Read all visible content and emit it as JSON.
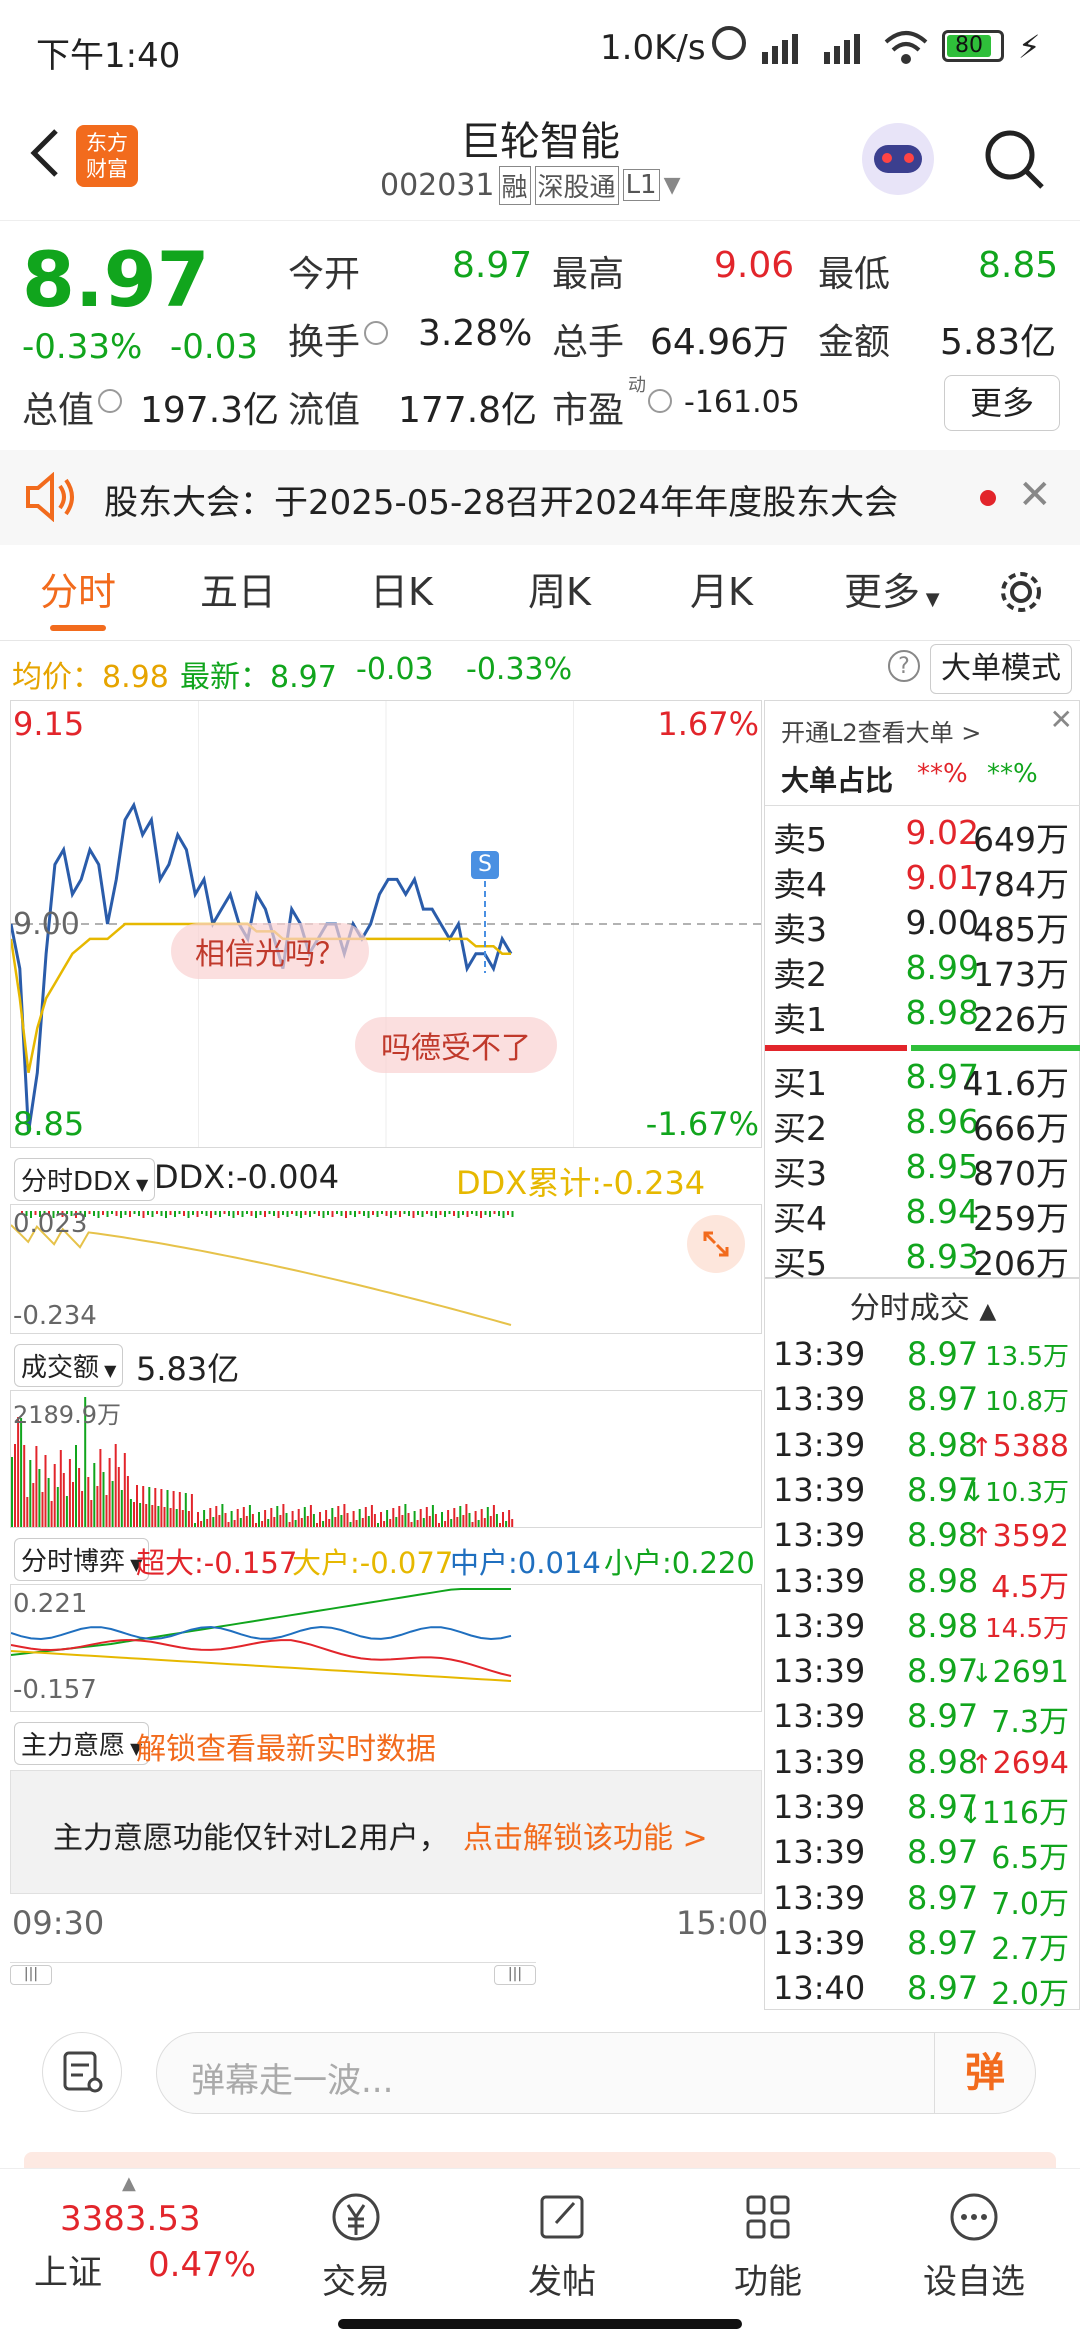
{
  "status": {
    "time": "下午1:40",
    "net_speed": "1.0K/s",
    "battery": "80"
  },
  "header": {
    "back_icon": "chevron-left-icon",
    "logo_text": "东方财富",
    "stock_name": "巨轮智能",
    "stock_code": "002031",
    "tags": [
      "融",
      "深股通",
      "L1"
    ]
  },
  "quote": {
    "price": "8.97",
    "change_pct": "-0.33%",
    "change": "-0.03",
    "fields": [
      {
        "label": "今开",
        "value": "8.97",
        "color": "green"
      },
      {
        "label": "最高",
        "value": "9.06",
        "color": "red"
      },
      {
        "label": "最低",
        "value": "8.85",
        "color": "green"
      },
      {
        "label": "换手",
        "value": "3.28%",
        "color": "plain"
      },
      {
        "label": "总手",
        "value": "64.96万",
        "color": "plain"
      },
      {
        "label": "金额",
        "value": "5.83亿",
        "color": "plain"
      },
      {
        "label": "总值",
        "value": "197.3亿",
        "color": "plain"
      },
      {
        "label": "流值",
        "value": "177.8亿",
        "color": "plain"
      },
      {
        "label": "市盈",
        "value": "-161.05",
        "color": "plain"
      }
    ],
    "pe_superscript": "动",
    "more_button": "更多"
  },
  "notice": {
    "text": "股东大会：于2025-05-28召开2024年年度股东大会"
  },
  "tabs": [
    "分时",
    "五日",
    "日K",
    "周K",
    "月K",
    "更多"
  ],
  "active_tab": "分时",
  "chart_header": {
    "avg_label": "均价：",
    "avg_value": "8.98",
    "latest_label": "最新：",
    "latest_value": "8.97",
    "change": "-0.03",
    "change_pct": "-0.33%",
    "mode_button": "大单模式"
  },
  "chart_data": {
    "type": "line",
    "ylim": [
      8.85,
      9.15
    ],
    "y_top_label": "9.15",
    "y_bottom_label": "8.85",
    "y_mid_label": "9.00",
    "pct_top": "1.67%",
    "pct_bottom": "-1.67%",
    "x_start": "09:30",
    "x_end": "15:00",
    "series": [
      {
        "values": [
          9.0,
          8.97,
          8.86,
          8.9,
          8.98,
          9.04,
          9.05,
          9.02,
          9.03,
          9.05,
          9.04,
          9.0,
          9.03,
          9.07,
          9.08,
          9.06,
          9.07,
          9.03,
          9.04,
          9.06,
          9.05,
          9.02,
          9.03,
          9.0,
          9.01,
          9.02,
          9.0,
          8.99,
          9.02,
          9.01,
          8.99,
          8.97,
          9.01,
          9.0,
          8.98,
          8.99,
          9.0,
          9.0,
          8.98,
          9.0,
          8.99,
          9.0,
          9.02,
          9.03,
          9.03,
          9.02,
          9.03,
          9.01,
          9.01,
          9.0,
          8.99,
          9.0,
          8.97,
          8.98,
          8.98,
          8.97,
          8.99,
          8.98
        ]
      },
      {
        "values": [
          8.99,
          8.95,
          8.9,
          8.93,
          8.95,
          8.96,
          8.97,
          8.98,
          8.985,
          8.99,
          8.99,
          8.99,
          8.995,
          9.0,
          9.0,
          9.0,
          9.0,
          9.0,
          9.0,
          9.0,
          9.0,
          9.0,
          9.0,
          9.0,
          9.0,
          9.0,
          9.0,
          9.0,
          8.995,
          8.995,
          8.995,
          8.99,
          8.99,
          8.99,
          8.99,
          8.99,
          8.99,
          8.99,
          8.99,
          8.99,
          8.99,
          8.99,
          8.99,
          8.99,
          8.99,
          8.99,
          8.99,
          8.99,
          8.99,
          8.99,
          8.99,
          8.99,
          8.99,
          8.985,
          8.985,
          8.985,
          8.98,
          8.98
        ]
      }
    ],
    "danmaku": [
      "相信光吗？",
      "吗德受不了"
    ],
    "s_marker": "S"
  },
  "ddx": {
    "selector": "分时DDX",
    "value_label": "DDX:",
    "value": "-0.004",
    "cum_label": "DDX累计:",
    "cum_value": "-0.234",
    "top": "0.023",
    "bottom": "-0.234"
  },
  "volume": {
    "selector": "成交额",
    "value": "5.83亿",
    "max_label": "2189.9万"
  },
  "game": {
    "selector": "分时博弈",
    "items": [
      {
        "label": "超大:",
        "value": "-0.157",
        "color": "#e2252b"
      },
      {
        "label": "大户:",
        "value": "-0.077",
        "color": "#e6b800"
      },
      {
        "label": "中户:",
        "value": "0.014",
        "color": "#1f6fbf"
      },
      {
        "label": "小户:",
        "value": "0.220",
        "color": "#11a51d"
      }
    ],
    "top": "0.221",
    "bottom": "-0.157"
  },
  "main_intent": {
    "selector": "主力意愿",
    "unlock_text": "解锁查看最新实时数据",
    "promo_text": "主力意愿功能仅针对L2用户，",
    "promo_link": "点击解锁该功能 >"
  },
  "orderbook": {
    "open_l2": "开通L2查看大单 >",
    "big_ratio_label": "大单占比",
    "big_ratio_red": "**%",
    "big_ratio_green": "**%",
    "sells": [
      {
        "label": "卖5",
        "price": "9.02",
        "vol": "649万",
        "color": "red"
      },
      {
        "label": "卖4",
        "price": "9.01",
        "vol": "784万",
        "color": "red"
      },
      {
        "label": "卖3",
        "price": "9.00",
        "vol": "485万",
        "color": "plain"
      },
      {
        "label": "卖2",
        "price": "8.99",
        "vol": "173万",
        "color": "green"
      },
      {
        "label": "卖1",
        "price": "8.98",
        "vol": "226万",
        "color": "green"
      }
    ],
    "buys": [
      {
        "label": "买1",
        "price": "8.97",
        "vol": "41.6万",
        "color": "green"
      },
      {
        "label": "买2",
        "price": "8.96",
        "vol": "666万",
        "color": "green"
      },
      {
        "label": "买3",
        "price": "8.95",
        "vol": "870万",
        "color": "green"
      },
      {
        "label": "买4",
        "price": "8.94",
        "vol": "259万",
        "color": "green"
      },
      {
        "label": "买5",
        "price": "8.93",
        "vol": "206万",
        "color": "green"
      }
    ],
    "sell_ratio": 0.45,
    "trades_title": "分时成交",
    "trades": [
      {
        "t": "13:39",
        "p": "8.97",
        "v": "13.5万",
        "pc": "green",
        "vc": "green",
        "arrow": ""
      },
      {
        "t": "13:39",
        "p": "8.97",
        "v": "10.8万",
        "pc": "green",
        "vc": "green",
        "arrow": ""
      },
      {
        "t": "13:39",
        "p": "8.98",
        "v": "5388",
        "pc": "green",
        "vc": "red",
        "arrow": "↑"
      },
      {
        "t": "13:39",
        "p": "8.97",
        "v": "10.3万",
        "pc": "green",
        "vc": "green",
        "arrow": "↓"
      },
      {
        "t": "13:39",
        "p": "8.98",
        "v": "3592",
        "pc": "green",
        "vc": "red",
        "arrow": "↑"
      },
      {
        "t": "13:39",
        "p": "8.98",
        "v": "4.5万",
        "pc": "green",
        "vc": "red",
        "arrow": ""
      },
      {
        "t": "13:39",
        "p": "8.98",
        "v": "14.5万",
        "pc": "green",
        "vc": "red",
        "arrow": ""
      },
      {
        "t": "13:39",
        "p": "8.97",
        "v": "2691",
        "pc": "green",
        "vc": "green",
        "arrow": "↓"
      },
      {
        "t": "13:39",
        "p": "8.97",
        "v": "7.3万",
        "pc": "green",
        "vc": "green",
        "arrow": ""
      },
      {
        "t": "13:39",
        "p": "8.98",
        "v": "2694",
        "pc": "green",
        "vc": "red",
        "arrow": "↑"
      },
      {
        "t": "13:39",
        "p": "8.97",
        "v": "116万",
        "pc": "green",
        "vc": "green",
        "arrow": "↓"
      },
      {
        "t": "13:39",
        "p": "8.97",
        "v": "6.5万",
        "pc": "green",
        "vc": "green",
        "arrow": ""
      },
      {
        "t": "13:39",
        "p": "8.97",
        "v": "7.0万",
        "pc": "green",
        "vc": "green",
        "arrow": ""
      },
      {
        "t": "13:39",
        "p": "8.97",
        "v": "2.7万",
        "pc": "green",
        "vc": "green",
        "arrow": ""
      },
      {
        "t": "13:40",
        "p": "8.97",
        "v": "2.0万",
        "pc": "green",
        "vc": "green",
        "arrow": ""
      }
    ]
  },
  "danmu_input": {
    "placeholder": "弹幕走一波...",
    "send_label": "弹"
  },
  "navbar": {
    "index_value": "3383.53",
    "index_name": "上证",
    "index_change": "0.47%",
    "items": [
      "交易",
      "发帖",
      "功能",
      "设自选"
    ]
  }
}
